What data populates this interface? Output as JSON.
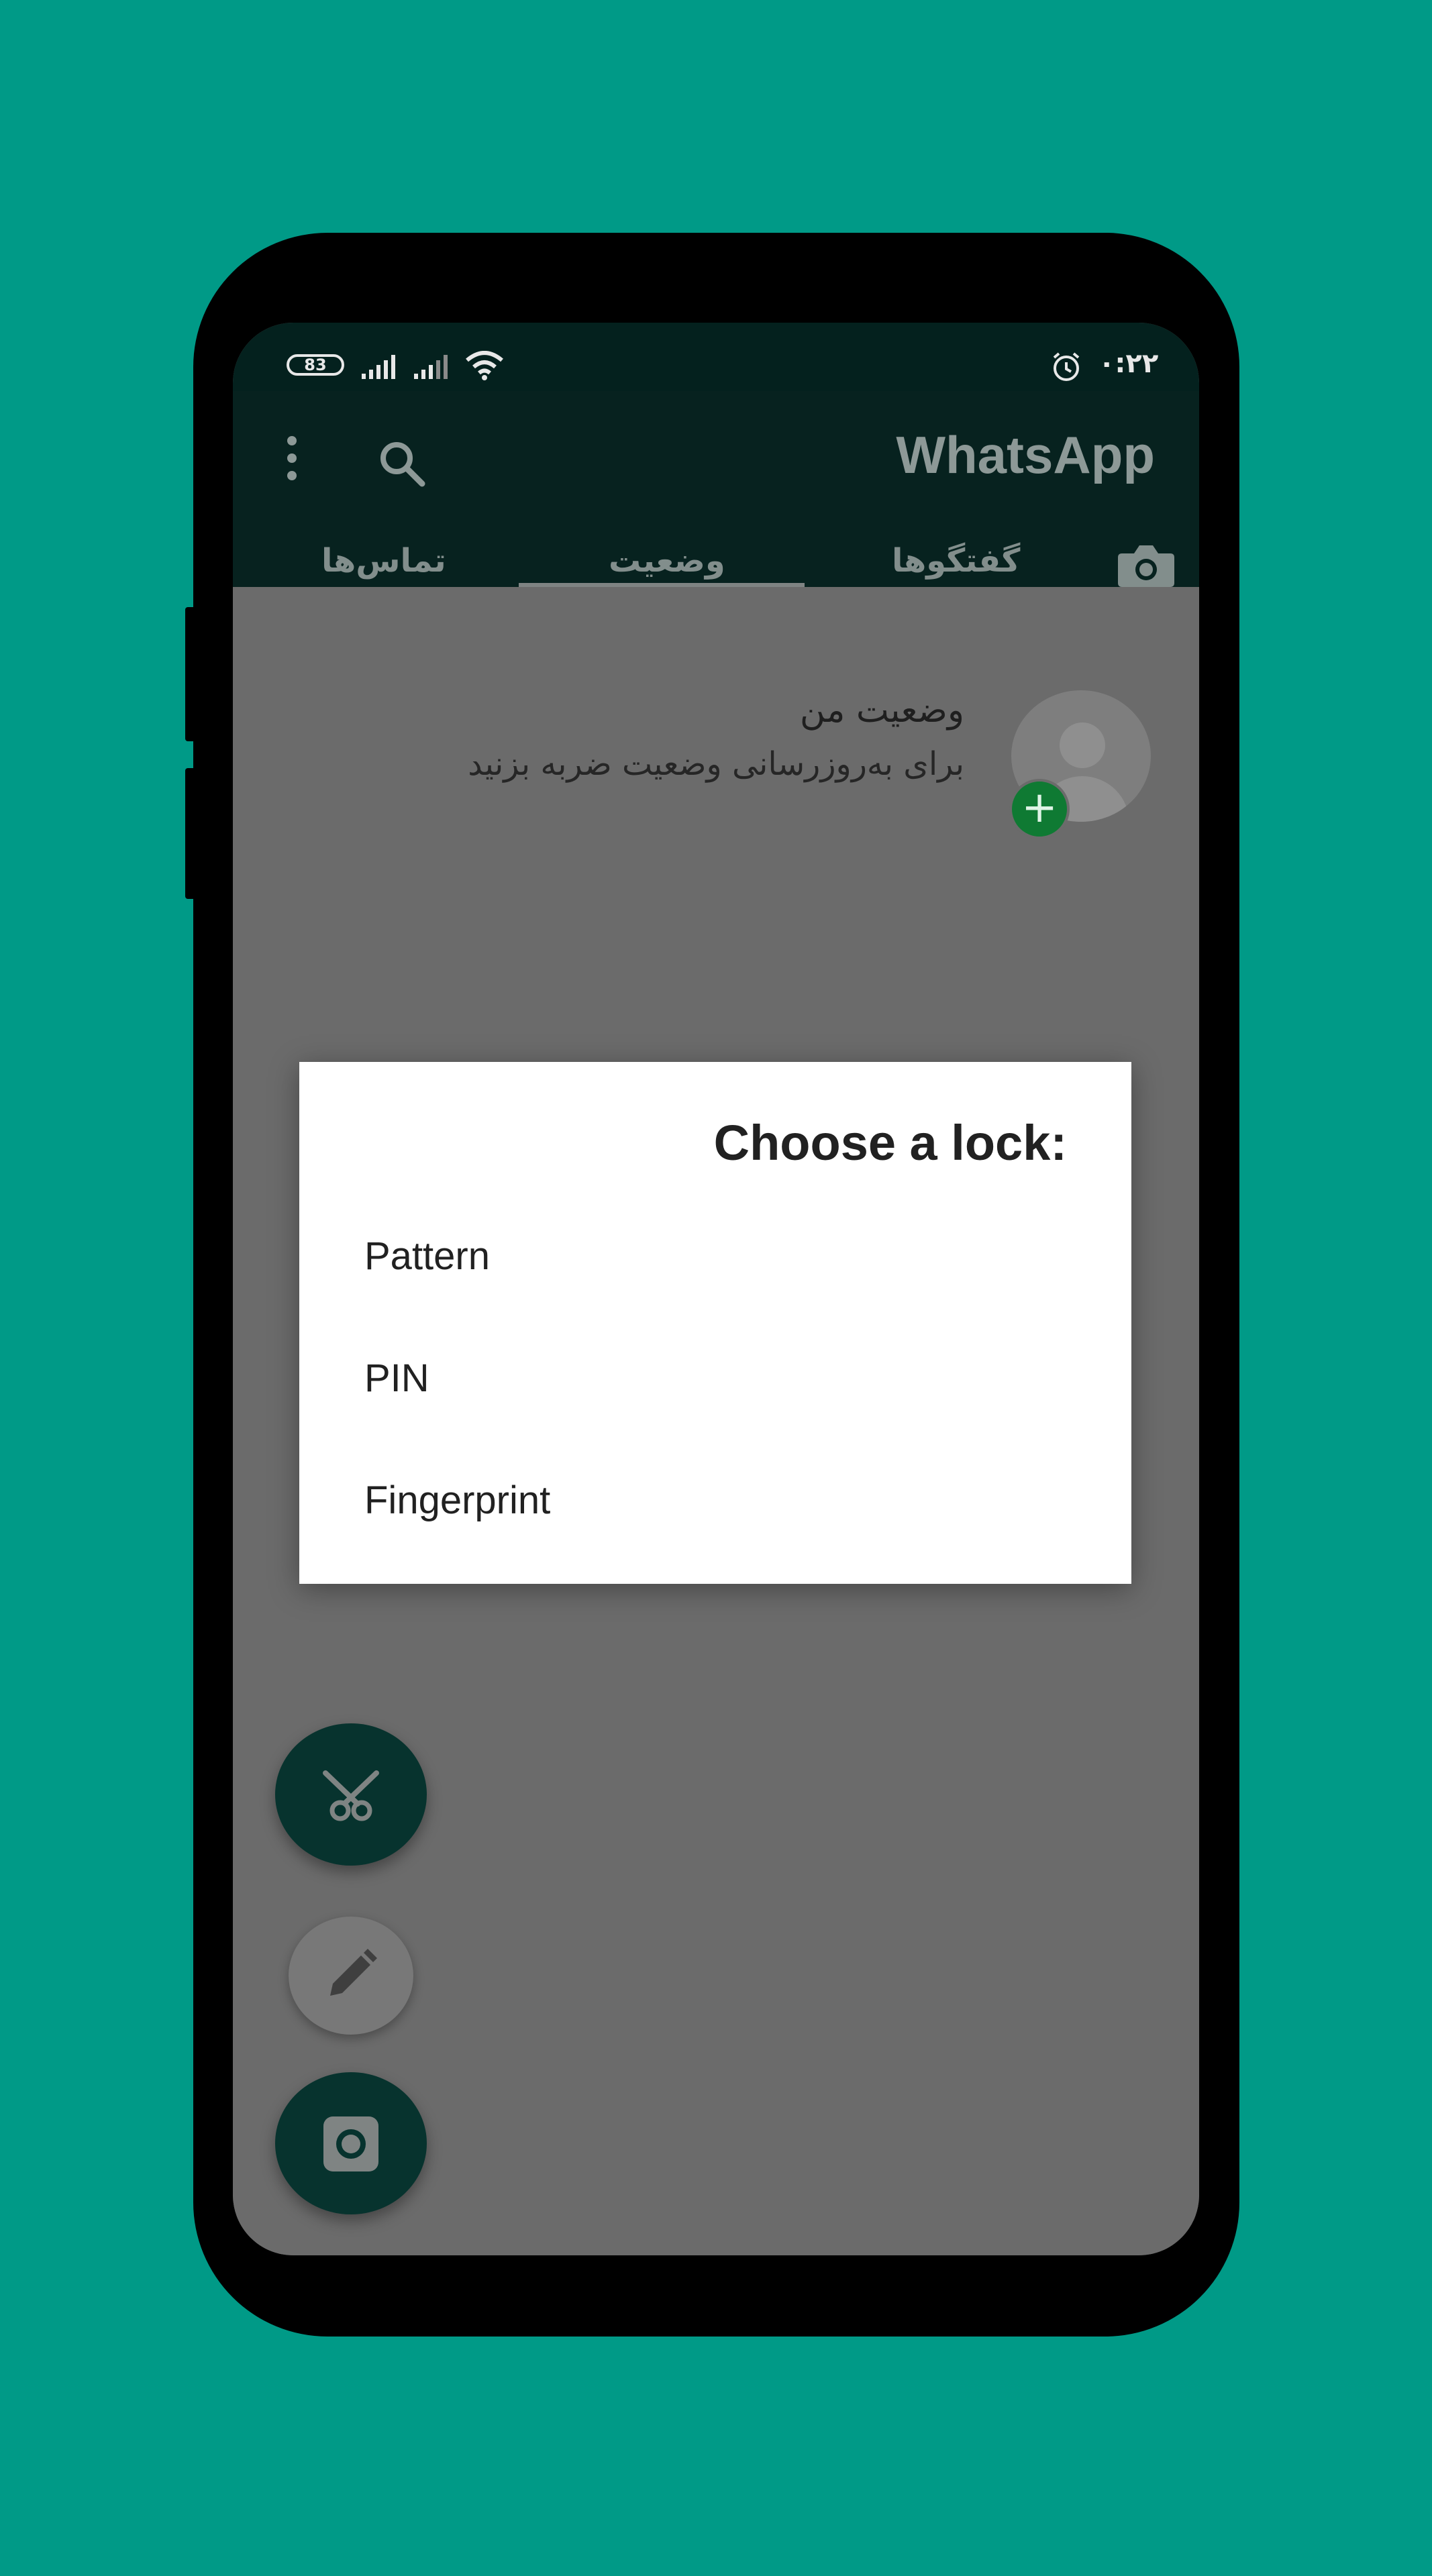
{
  "background_color": "#009a87",
  "statusbar": {
    "battery": "83",
    "time": "۰:۲۲",
    "icons": [
      "battery-icon",
      "signal-icon",
      "signal-icon",
      "wifi-icon",
      "alarm-icon"
    ]
  },
  "appbar": {
    "title": "WhatsApp",
    "menu_icon": "more-vert-icon",
    "search_icon": "search-icon",
    "camera_icon": "camera-icon"
  },
  "tabs": [
    {
      "label": "گفتگوها",
      "selected": false
    },
    {
      "label": "وضعیت",
      "selected": true
    },
    {
      "label": "تماس‌ها",
      "selected": false
    }
  ],
  "my_status": {
    "title": "وضعیت من",
    "subtitle": "برای به‌روزرسانی وضعیت ضربه بزنید"
  },
  "dialog": {
    "title": "Choose a lock:",
    "options": [
      "Pattern",
      "PIN",
      "Fingerprint"
    ]
  },
  "fabs": [
    "scissors-icon",
    "pencil-icon",
    "camera-icon"
  ]
}
